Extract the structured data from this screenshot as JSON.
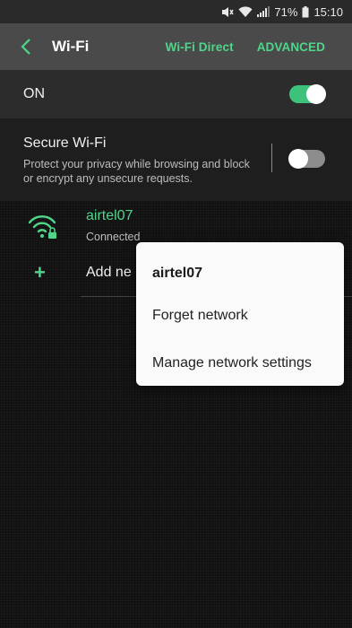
{
  "status_bar": {
    "battery_percent": "71%",
    "time": "15:10",
    "icons": [
      "mute-icon",
      "wifi-signal-icon",
      "cell-signal-icon",
      "battery-icon"
    ]
  },
  "app_bar": {
    "title": "Wi-Fi",
    "back_icon": "chevron-left-icon",
    "actions": {
      "wifi_direct": "Wi-Fi Direct",
      "advanced": "ADVANCED"
    }
  },
  "master_switch": {
    "label": "ON",
    "state": "on"
  },
  "secure_wifi": {
    "title": "Secure Wi-Fi",
    "description": "Protect your privacy while browsing and block or encrypt any unsecure requests.",
    "state": "off"
  },
  "networks": [
    {
      "name": "airtel07",
      "status": "Connected",
      "icon": "wifi-lock-icon"
    }
  ],
  "add_network": {
    "label": "Add network",
    "visible_label": "Add ne",
    "icon": "plus-icon"
  },
  "context_menu": {
    "title": "airtel07",
    "items": [
      "Forget network",
      "Manage network settings"
    ]
  },
  "colors": {
    "accent": "#4fd68a",
    "toggle_on": "#3cc27a",
    "toggle_off": "#8c8c8c",
    "app_bar": "#4a4a4a",
    "background": "#141414",
    "popup": "#fafafa"
  }
}
